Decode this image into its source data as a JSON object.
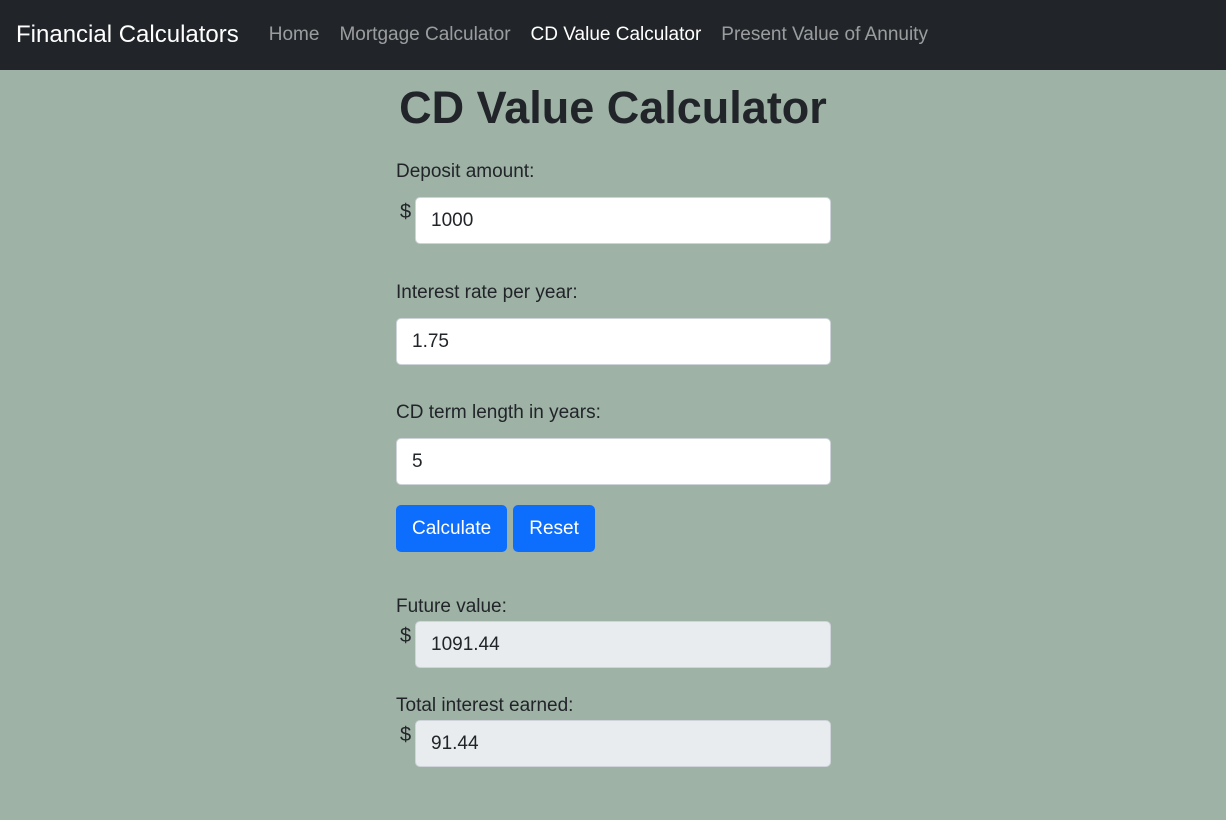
{
  "navbar": {
    "brand": "Financial Calculators",
    "links": [
      {
        "label": "Home",
        "active": false
      },
      {
        "label": "Mortgage Calculator",
        "active": false
      },
      {
        "label": "CD Value Calculator",
        "active": true
      },
      {
        "label": "Present Value of Annuity",
        "active": false
      }
    ]
  },
  "page": {
    "title": "CD Value Calculator"
  },
  "form": {
    "deposit": {
      "label": "Deposit amount:",
      "currency": "$",
      "value": "1000"
    },
    "rate": {
      "label": "Interest rate per year:",
      "value": "1.75"
    },
    "term": {
      "label": "CD term length in years:",
      "value": "5"
    },
    "calculate_label": "Calculate",
    "reset_label": "Reset"
  },
  "results": {
    "future_value": {
      "label": "Future value:",
      "currency": "$",
      "value": "1091.44"
    },
    "total_interest": {
      "label": "Total interest earned:",
      "currency": "$",
      "value": "91.44"
    }
  },
  "colors": {
    "background": "#9fb2a6",
    "navbar": "#212529",
    "primary_button": "#0d6efd",
    "readonly_field": "#e9ecef"
  }
}
